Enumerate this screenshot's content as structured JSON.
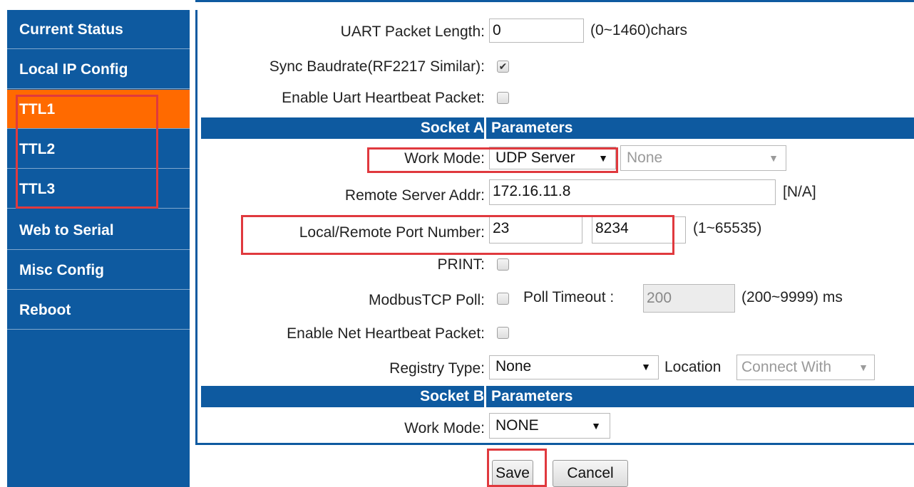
{
  "sidebar": {
    "items": [
      {
        "label": "Current Status"
      },
      {
        "label": "Local IP Config"
      },
      {
        "label": "TTL1"
      },
      {
        "label": "TTL2"
      },
      {
        "label": "TTL3"
      },
      {
        "label": "Web to Serial"
      },
      {
        "label": "Misc Config"
      },
      {
        "label": "Reboot"
      }
    ],
    "active": "TTL1"
  },
  "form": {
    "uart_packet_length": {
      "label": "UART Packet Length:",
      "value": "0",
      "hint": "(0~1460)chars"
    },
    "sync_baudrate": {
      "label": "Sync Baudrate(RF2217 Similar):",
      "checked": true
    },
    "enable_uart_heartbeat": {
      "label": "Enable Uart Heartbeat Packet:",
      "checked": false
    },
    "socket_a": {
      "header_left": "Socket A",
      "header_right": "Parameters",
      "work_mode": {
        "label": "Work Mode:",
        "value": "UDP Server",
        "secondary": "None"
      },
      "remote_server_addr": {
        "label": "Remote Server Addr:",
        "value": "172.16.11.8",
        "hint": "[N/A]"
      },
      "port_number": {
        "label": "Local/Remote Port Number:",
        "local": "23",
        "remote": "8234",
        "hint": "(1~65535)"
      },
      "print": {
        "label": "PRINT:",
        "checked": false
      },
      "modbus_poll": {
        "label": "ModbusTCP Poll:",
        "checked": false,
        "timeout_label": "Poll Timeout :",
        "timeout_value": "200",
        "hint": "(200~9999) ms"
      },
      "net_heartbeat": {
        "label": "Enable Net Heartbeat Packet:",
        "checked": false
      },
      "registry_type": {
        "label": "Registry Type:",
        "value": "None",
        "location_label": "Location",
        "location_value": "Connect With"
      }
    },
    "socket_b": {
      "header_left": "Socket B",
      "header_right": "Parameters",
      "work_mode": {
        "label": "Work Mode:",
        "value": "NONE"
      }
    }
  },
  "buttons": {
    "save": "Save",
    "cancel": "Cancel"
  },
  "colors": {
    "nav_bg": "#0e5aa0",
    "active": "#ff6a00",
    "highlight": "#e0393e"
  },
  "icons": {
    "dropdown": "caret-down",
    "check": "checkmark"
  }
}
